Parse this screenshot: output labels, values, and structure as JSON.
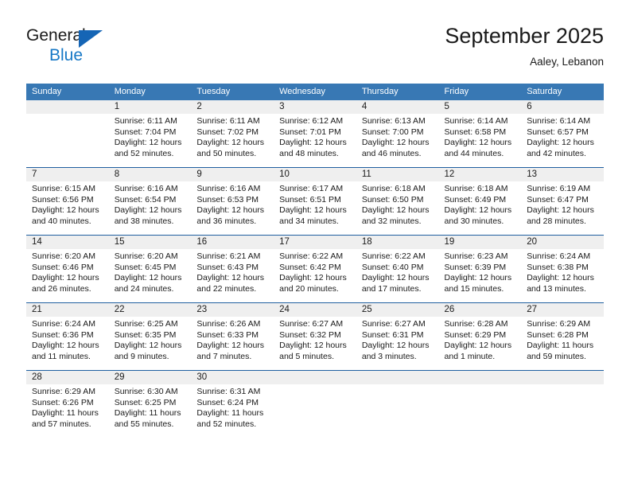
{
  "brand": {
    "name_top": "General",
    "name_bottom": "Blue",
    "accent_color": "#1778c6",
    "triangle_color": "#1565b5"
  },
  "header": {
    "month_title": "September 2025",
    "location": "Aaley, Lebanon"
  },
  "theme": {
    "header_row_bg": "#3878b4",
    "header_row_text": "#ffffff",
    "daynum_band_bg": "#efefef",
    "row_divider": "#1f5fa0",
    "body_bg": "#ffffff",
    "text": "#1a1a1a"
  },
  "calendar": {
    "weekday_headers": [
      "Sunday",
      "Monday",
      "Tuesday",
      "Wednesday",
      "Thursday",
      "Friday",
      "Saturday"
    ],
    "labels": {
      "sunrise": "Sunrise:",
      "sunset": "Sunset:",
      "daylight": "Daylight:"
    },
    "weeks": [
      [
        {
          "day": "",
          "sunrise": "",
          "sunset": "",
          "daylight_line1": "",
          "daylight_line2": ""
        },
        {
          "day": "1",
          "sunrise": "Sunrise: 6:11 AM",
          "sunset": "Sunset: 7:04 PM",
          "daylight_line1": "Daylight: 12 hours",
          "daylight_line2": "and 52 minutes."
        },
        {
          "day": "2",
          "sunrise": "Sunrise: 6:11 AM",
          "sunset": "Sunset: 7:02 PM",
          "daylight_line1": "Daylight: 12 hours",
          "daylight_line2": "and 50 minutes."
        },
        {
          "day": "3",
          "sunrise": "Sunrise: 6:12 AM",
          "sunset": "Sunset: 7:01 PM",
          "daylight_line1": "Daylight: 12 hours",
          "daylight_line2": "and 48 minutes."
        },
        {
          "day": "4",
          "sunrise": "Sunrise: 6:13 AM",
          "sunset": "Sunset: 7:00 PM",
          "daylight_line1": "Daylight: 12 hours",
          "daylight_line2": "and 46 minutes."
        },
        {
          "day": "5",
          "sunrise": "Sunrise: 6:14 AM",
          "sunset": "Sunset: 6:58 PM",
          "daylight_line1": "Daylight: 12 hours",
          "daylight_line2": "and 44 minutes."
        },
        {
          "day": "6",
          "sunrise": "Sunrise: 6:14 AM",
          "sunset": "Sunset: 6:57 PM",
          "daylight_line1": "Daylight: 12 hours",
          "daylight_line2": "and 42 minutes."
        }
      ],
      [
        {
          "day": "7",
          "sunrise": "Sunrise: 6:15 AM",
          "sunset": "Sunset: 6:56 PM",
          "daylight_line1": "Daylight: 12 hours",
          "daylight_line2": "and 40 minutes."
        },
        {
          "day": "8",
          "sunrise": "Sunrise: 6:16 AM",
          "sunset": "Sunset: 6:54 PM",
          "daylight_line1": "Daylight: 12 hours",
          "daylight_line2": "and 38 minutes."
        },
        {
          "day": "9",
          "sunrise": "Sunrise: 6:16 AM",
          "sunset": "Sunset: 6:53 PM",
          "daylight_line1": "Daylight: 12 hours",
          "daylight_line2": "and 36 minutes."
        },
        {
          "day": "10",
          "sunrise": "Sunrise: 6:17 AM",
          "sunset": "Sunset: 6:51 PM",
          "daylight_line1": "Daylight: 12 hours",
          "daylight_line2": "and 34 minutes."
        },
        {
          "day": "11",
          "sunrise": "Sunrise: 6:18 AM",
          "sunset": "Sunset: 6:50 PM",
          "daylight_line1": "Daylight: 12 hours",
          "daylight_line2": "and 32 minutes."
        },
        {
          "day": "12",
          "sunrise": "Sunrise: 6:18 AM",
          "sunset": "Sunset: 6:49 PM",
          "daylight_line1": "Daylight: 12 hours",
          "daylight_line2": "and 30 minutes."
        },
        {
          "day": "13",
          "sunrise": "Sunrise: 6:19 AM",
          "sunset": "Sunset: 6:47 PM",
          "daylight_line1": "Daylight: 12 hours",
          "daylight_line2": "and 28 minutes."
        }
      ],
      [
        {
          "day": "14",
          "sunrise": "Sunrise: 6:20 AM",
          "sunset": "Sunset: 6:46 PM",
          "daylight_line1": "Daylight: 12 hours",
          "daylight_line2": "and 26 minutes."
        },
        {
          "day": "15",
          "sunrise": "Sunrise: 6:20 AM",
          "sunset": "Sunset: 6:45 PM",
          "daylight_line1": "Daylight: 12 hours",
          "daylight_line2": "and 24 minutes."
        },
        {
          "day": "16",
          "sunrise": "Sunrise: 6:21 AM",
          "sunset": "Sunset: 6:43 PM",
          "daylight_line1": "Daylight: 12 hours",
          "daylight_line2": "and 22 minutes."
        },
        {
          "day": "17",
          "sunrise": "Sunrise: 6:22 AM",
          "sunset": "Sunset: 6:42 PM",
          "daylight_line1": "Daylight: 12 hours",
          "daylight_line2": "and 20 minutes."
        },
        {
          "day": "18",
          "sunrise": "Sunrise: 6:22 AM",
          "sunset": "Sunset: 6:40 PM",
          "daylight_line1": "Daylight: 12 hours",
          "daylight_line2": "and 17 minutes."
        },
        {
          "day": "19",
          "sunrise": "Sunrise: 6:23 AM",
          "sunset": "Sunset: 6:39 PM",
          "daylight_line1": "Daylight: 12 hours",
          "daylight_line2": "and 15 minutes."
        },
        {
          "day": "20",
          "sunrise": "Sunrise: 6:24 AM",
          "sunset": "Sunset: 6:38 PM",
          "daylight_line1": "Daylight: 12 hours",
          "daylight_line2": "and 13 minutes."
        }
      ],
      [
        {
          "day": "21",
          "sunrise": "Sunrise: 6:24 AM",
          "sunset": "Sunset: 6:36 PM",
          "daylight_line1": "Daylight: 12 hours",
          "daylight_line2": "and 11 minutes."
        },
        {
          "day": "22",
          "sunrise": "Sunrise: 6:25 AM",
          "sunset": "Sunset: 6:35 PM",
          "daylight_line1": "Daylight: 12 hours",
          "daylight_line2": "and 9 minutes."
        },
        {
          "day": "23",
          "sunrise": "Sunrise: 6:26 AM",
          "sunset": "Sunset: 6:33 PM",
          "daylight_line1": "Daylight: 12 hours",
          "daylight_line2": "and 7 minutes."
        },
        {
          "day": "24",
          "sunrise": "Sunrise: 6:27 AM",
          "sunset": "Sunset: 6:32 PM",
          "daylight_line1": "Daylight: 12 hours",
          "daylight_line2": "and 5 minutes."
        },
        {
          "day": "25",
          "sunrise": "Sunrise: 6:27 AM",
          "sunset": "Sunset: 6:31 PM",
          "daylight_line1": "Daylight: 12 hours",
          "daylight_line2": "and 3 minutes."
        },
        {
          "day": "26",
          "sunrise": "Sunrise: 6:28 AM",
          "sunset": "Sunset: 6:29 PM",
          "daylight_line1": "Daylight: 12 hours",
          "daylight_line2": "and 1 minute."
        },
        {
          "day": "27",
          "sunrise": "Sunrise: 6:29 AM",
          "sunset": "Sunset: 6:28 PM",
          "daylight_line1": "Daylight: 11 hours",
          "daylight_line2": "and 59 minutes."
        }
      ],
      [
        {
          "day": "28",
          "sunrise": "Sunrise: 6:29 AM",
          "sunset": "Sunset: 6:26 PM",
          "daylight_line1": "Daylight: 11 hours",
          "daylight_line2": "and 57 minutes."
        },
        {
          "day": "29",
          "sunrise": "Sunrise: 6:30 AM",
          "sunset": "Sunset: 6:25 PM",
          "daylight_line1": "Daylight: 11 hours",
          "daylight_line2": "and 55 minutes."
        },
        {
          "day": "30",
          "sunrise": "Sunrise: 6:31 AM",
          "sunset": "Sunset: 6:24 PM",
          "daylight_line1": "Daylight: 11 hours",
          "daylight_line2": "and 52 minutes."
        },
        {
          "day": "",
          "sunrise": "",
          "sunset": "",
          "daylight_line1": "",
          "daylight_line2": ""
        },
        {
          "day": "",
          "sunrise": "",
          "sunset": "",
          "daylight_line1": "",
          "daylight_line2": ""
        },
        {
          "day": "",
          "sunrise": "",
          "sunset": "",
          "daylight_line1": "",
          "daylight_line2": ""
        },
        {
          "day": "",
          "sunrise": "",
          "sunset": "",
          "daylight_line1": "",
          "daylight_line2": ""
        }
      ]
    ]
  }
}
